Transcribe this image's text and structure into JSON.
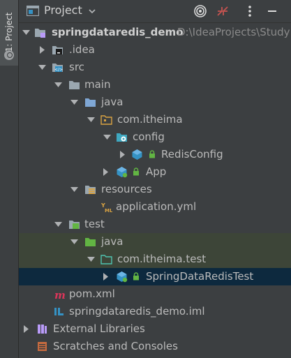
{
  "side_tab": {
    "label": "1: Project"
  },
  "header": {
    "title": "Project"
  },
  "tree": [
    {
      "label": "springdataredis_demo",
      "path": "D:\\IdeaProjects\\Study"
    },
    {
      "label": ".idea"
    },
    {
      "label": "src"
    },
    {
      "label": "main"
    },
    {
      "label": "java"
    },
    {
      "label": "com.itheima"
    },
    {
      "label": "config"
    },
    {
      "label": "RedisConfig"
    },
    {
      "label": "App"
    },
    {
      "label": "resources"
    },
    {
      "label": "application.yml"
    },
    {
      "label": "test"
    },
    {
      "label": "java"
    },
    {
      "label": "com.itheima.test"
    },
    {
      "label": "SpringDataRedisTest"
    },
    {
      "label": "pom.xml"
    },
    {
      "label": "springdataredis_demo.iml"
    },
    {
      "label": "External Libraries"
    },
    {
      "label": "Scratches and Consoles"
    }
  ],
  "colors": {
    "background": "#3c3f41",
    "selection": "#0d293e",
    "test_highlight": "#3d4538",
    "folder_blue": "#7fa7d5",
    "folder_green": "#62b543",
    "module_purple": "#b99bf8"
  }
}
